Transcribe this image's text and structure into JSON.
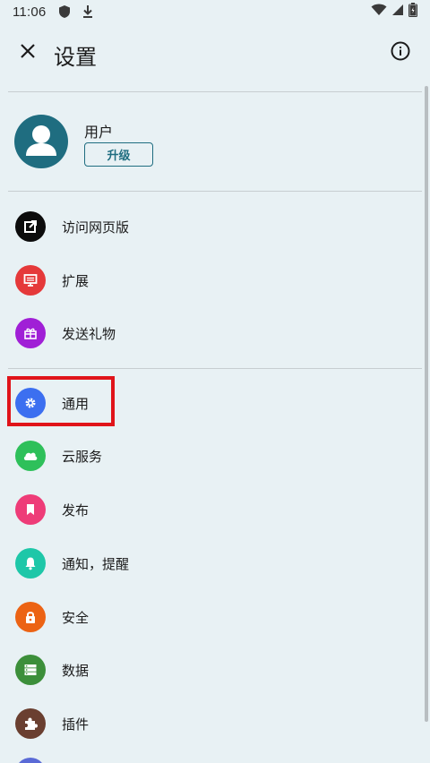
{
  "status_bar": {
    "time": "11:06",
    "icons_left": [
      "shield-icon",
      "download-icon"
    ],
    "icons_right": [
      "wifi-icon",
      "signal-icon",
      "battery-icon"
    ]
  },
  "app_bar": {
    "title": "设置",
    "close_icon": "close-icon",
    "info_icon": "info-icon"
  },
  "profile": {
    "name": "用户",
    "upgrade_label": "升级"
  },
  "menu_groups": [
    {
      "items": [
        {
          "label": "访问网页版",
          "icon": "open-external-icon",
          "color": "#0c0c0c"
        },
        {
          "label": "扩展",
          "icon": "monitor-icon",
          "color": "#e5393a"
        },
        {
          "label": "发送礼物",
          "icon": "gift-icon",
          "color": "#a01fd6"
        }
      ]
    },
    {
      "items": [
        {
          "label": "通用",
          "icon": "gear-icon",
          "color": "#3c6ff0",
          "highlighted": true
        },
        {
          "label": "云服务",
          "icon": "cloud-icon",
          "color": "#2ec05a"
        },
        {
          "label": "发布",
          "icon": "bookmark-icon",
          "color": "#ee3c78"
        },
        {
          "label": "通知，提醒",
          "icon": "bell-icon",
          "color": "#1ec7a8"
        },
        {
          "label": "安全",
          "icon": "lock-icon",
          "color": "#ec6314"
        },
        {
          "label": "数据",
          "icon": "storage-icon",
          "color": "#3c8f3a"
        },
        {
          "label": "插件",
          "icon": "puzzle-icon",
          "color": "#6a3f30"
        }
      ]
    }
  ],
  "colors": {
    "background": "#e8f1f4",
    "accent": "#1f6d80",
    "highlight_border": "#e0141a"
  }
}
